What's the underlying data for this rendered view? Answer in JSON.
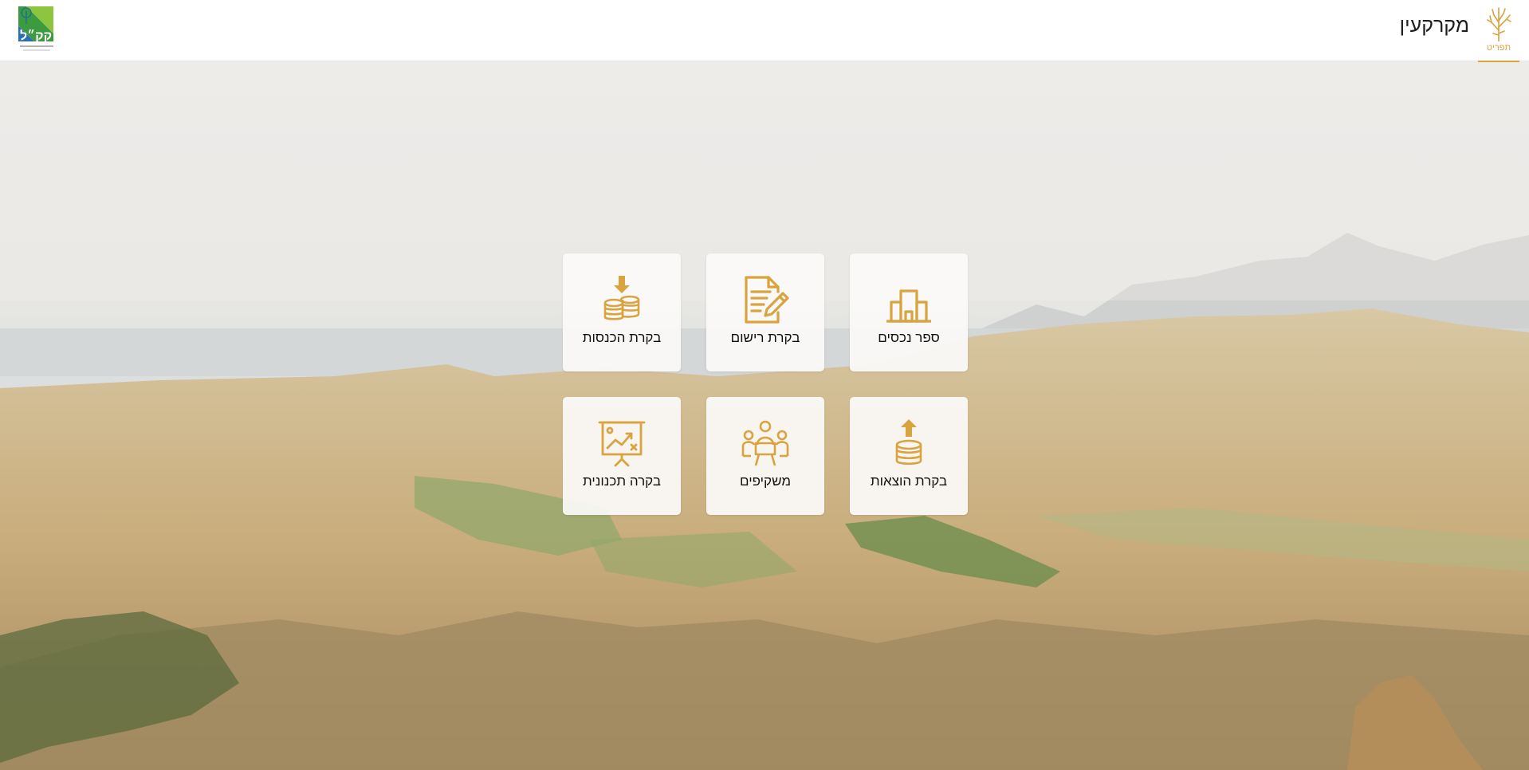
{
  "header": {
    "title": "מקרקעין",
    "menu_label": "תפריט",
    "logo_icon": "kkl-logo",
    "menu_icon": "tree-icon",
    "logo_text": "קק\"ל קרן קיימת לישראל KKL-JNF"
  },
  "colors": {
    "accent": "#d9a33f",
    "header_bg": "#ffffff",
    "tile_bg": "#fbfaf9",
    "text": "#1e1e1e"
  },
  "tiles": [
    {
      "label": "ספר נכסים",
      "icon": "buildings-icon"
    },
    {
      "label": "בקרת רישום",
      "icon": "document-pen-icon"
    },
    {
      "label": "בקרת הכנסות",
      "icon": "coins-download-icon"
    },
    {
      "label": "בקרת הוצאות",
      "icon": "coins-upload-icon"
    },
    {
      "label": "משקיפים",
      "icon": "meeting-people-icon"
    },
    {
      "label": "בקרה תכנונית",
      "icon": "presentation-chart-icon"
    }
  ]
}
